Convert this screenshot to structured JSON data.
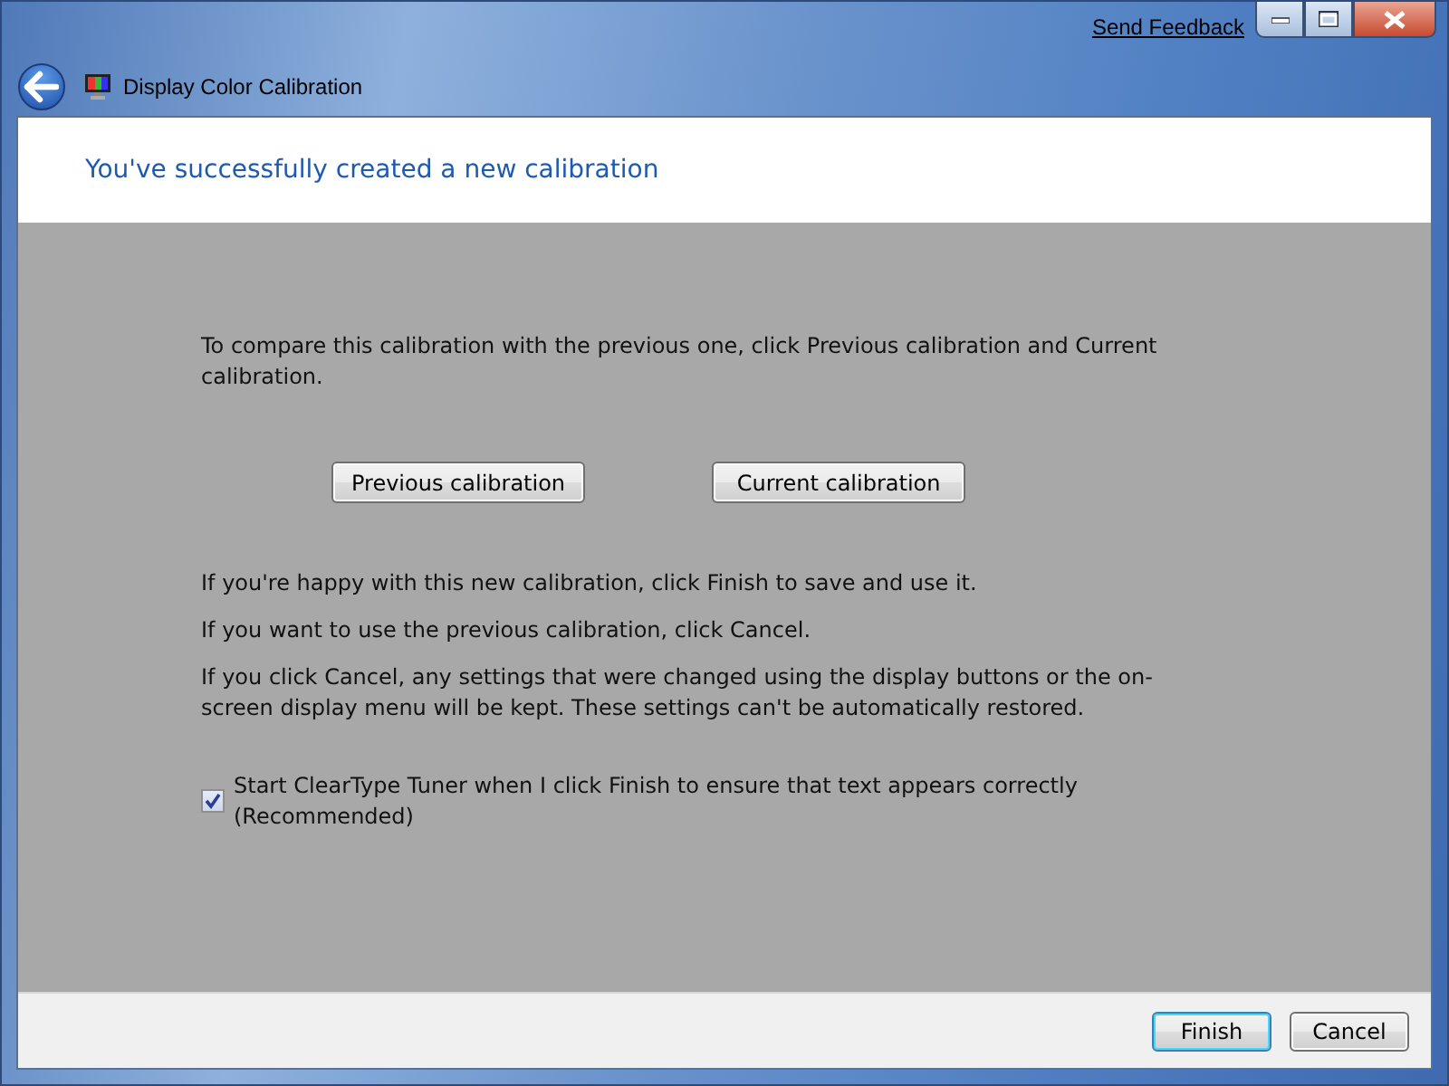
{
  "window": {
    "title": "Display Color Calibration",
    "feedback_link": "Send Feedback",
    "controls": [
      {
        "kind": "minimize"
      },
      {
        "kind": "maximize"
      },
      {
        "kind": "close"
      }
    ]
  },
  "heading": "You've successfully created a new calibration",
  "intro": "To compare this calibration with the previous one, click Previous calibration and Current calibration.",
  "compare_buttons": [
    "Previous calibration",
    "Current calibration"
  ],
  "paragraphs": [
    "If you're happy with this new calibration, click Finish to save and use it.",
    "If you want to use the previous calibration, click Cancel.",
    "If you click Cancel, any settings that were changed using the display buttons or the on-screen display menu will be kept. These settings can't be automatically restored."
  ],
  "cleartype_option": {
    "label": "Start ClearType Tuner when I click Finish to ensure that text appears correctly (Recommended)",
    "checked": true
  },
  "buttons": [
    {
      "label": "Finish",
      "default": true
    },
    {
      "label": "Cancel",
      "default": false
    }
  ]
}
